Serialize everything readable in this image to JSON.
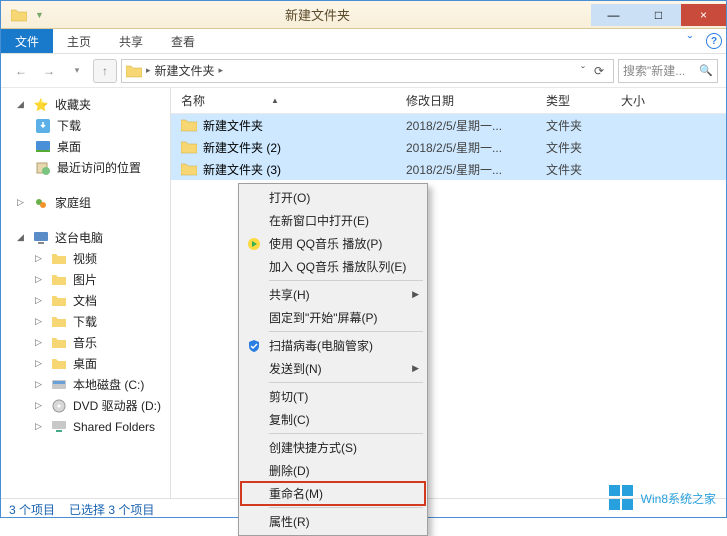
{
  "title": "新建文件夹",
  "win_controls": {
    "min": "—",
    "max": "□",
    "close": "×"
  },
  "ribbon": {
    "file": "文件",
    "tabs": [
      "主页",
      "共享",
      "查看"
    ],
    "expand": "ˇ",
    "help": "?"
  },
  "nav": {
    "back": "←",
    "fwd": "→",
    "hist": "▾",
    "up": "↑",
    "refresh": "⟳"
  },
  "breadcrumb": {
    "root_arrow": "▸",
    "seg": "新建文件夹",
    "seg_arrow": "▸",
    "dropdown": "ˇ"
  },
  "search": {
    "placeholder": "搜索\"新建...",
    "icon": "🔍"
  },
  "sidebar": {
    "fav": {
      "label": "收藏夹",
      "items": [
        "下载",
        "桌面",
        "最近访问的位置"
      ]
    },
    "homegroup": "家庭组",
    "pc": {
      "label": "这台电脑",
      "items": [
        "视频",
        "图片",
        "文档",
        "下载",
        "音乐",
        "桌面",
        "本地磁盘 (C:)",
        "DVD 驱动器 (D:)",
        "Shared Folders"
      ]
    }
  },
  "columns": {
    "name": "名称",
    "date": "修改日期",
    "type": "类型",
    "size": "大小"
  },
  "rows": [
    {
      "name": "新建文件夹",
      "date": "2018/2/5/星期一...",
      "type": "文件夹"
    },
    {
      "name": "新建文件夹 (2)",
      "date": "2018/2/5/星期一...",
      "type": "文件夹"
    },
    {
      "name": "新建文件夹 (3)",
      "date": "2018/2/5/星期一...",
      "type": "文件夹"
    }
  ],
  "status": {
    "count": "3 个项目",
    "selected": "已选择 3 个项目"
  },
  "context": {
    "items": [
      {
        "t": "打开(O)"
      },
      {
        "t": "在新窗口中打开(E)"
      },
      {
        "t": "使用 QQ音乐 播放(P)",
        "icon": "qq"
      },
      {
        "t": "加入 QQ音乐 播放队列(E)"
      },
      {
        "sep": true
      },
      {
        "t": "共享(H)",
        "sub": true
      },
      {
        "t": "固定到\"开始\"屏幕(P)"
      },
      {
        "sep": true
      },
      {
        "t": "扫描病毒(电脑管家)",
        "icon": "shield"
      },
      {
        "t": "发送到(N)",
        "sub": true
      },
      {
        "sep": true
      },
      {
        "t": "剪切(T)"
      },
      {
        "t": "复制(C)"
      },
      {
        "sep": true
      },
      {
        "t": "创建快捷方式(S)"
      },
      {
        "t": "删除(D)"
      },
      {
        "t": "重命名(M)",
        "hl": true
      },
      {
        "sep": true
      },
      {
        "t": "属性(R)"
      }
    ]
  },
  "watermark": "Win8系统之家",
  "colors": {
    "accent": "#1296db",
    "sel": "#cde8ff"
  }
}
